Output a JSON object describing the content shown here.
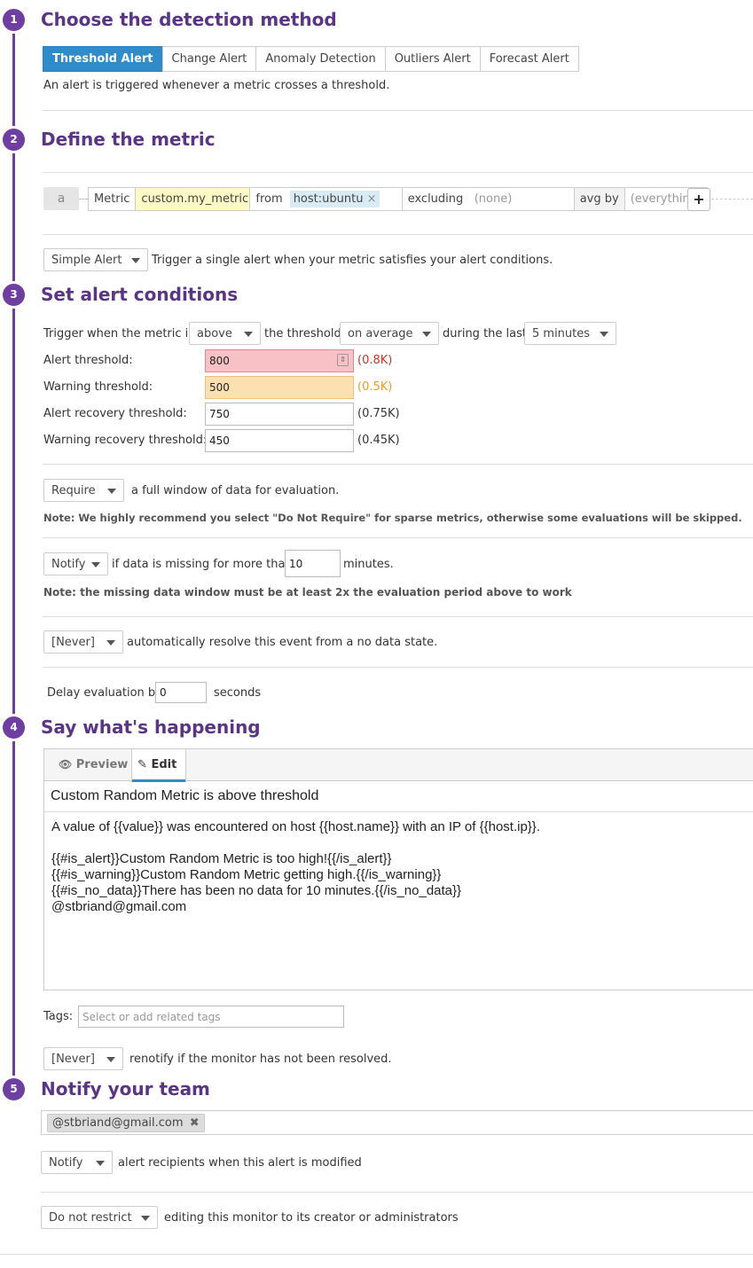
{
  "steps": [
    {
      "num": "1",
      "title": "Choose the detection method"
    },
    {
      "num": "2",
      "title": "Define the metric"
    },
    {
      "num": "3",
      "title": "Set alert conditions"
    },
    {
      "num": "4",
      "title": "Say what's happening"
    },
    {
      "num": "5",
      "title": "Notify your team"
    }
  ],
  "detection": {
    "tabs": [
      "Threshold Alert",
      "Change Alert",
      "Anomaly Detection",
      "Outliers Alert",
      "Forecast Alert"
    ],
    "active_tab": "Threshold Alert",
    "description": "An alert is triggered whenever a metric crosses a threshold."
  },
  "metric": {
    "query_letter": "a",
    "metric_label": "Metric",
    "metric_value": "custom.my_metric",
    "from_label": "from",
    "from_tag": "host:ubuntu",
    "from_tag_remove": "×",
    "excluding_label": "excluding",
    "excluding_value": "(none)",
    "avgby_label": "avg by",
    "avgby_value": "(everything)",
    "add_label": "+",
    "alert_type": "Simple Alert",
    "alert_type_desc": "Trigger a single alert when your metric satisfies your alert conditions."
  },
  "conditions": {
    "trigger_prefix": "Trigger when the metric is",
    "comparator": "above",
    "threshold_word": "the threshold",
    "aggregation": "on average",
    "during_word": "during the last",
    "window": "5 minutes",
    "alert_label": "Alert threshold:",
    "alert_value": "800",
    "alert_hint": "(0.8K)",
    "warning_label": "Warning threshold:",
    "warning_value": "500",
    "warning_hint": "(0.5K)",
    "alert_recovery_label": "Alert recovery threshold:",
    "alert_recovery_value": "750",
    "alert_recovery_hint": "(0.75K)",
    "warning_recovery_label": "Warning recovery threshold:",
    "warning_recovery_value": "450",
    "warning_recovery_hint": "(0.45K)",
    "require": "Require",
    "require_desc": "a full window of data for evaluation.",
    "require_note": "Note: We highly recommend you select \"Do Not Require\" for sparse metrics, otherwise some evaluations will be skipped.",
    "notify": "Notify",
    "notify_desc": "if data is missing for more than",
    "missing_minutes": "10",
    "minutes_word": "minutes.",
    "missing_note": "Note: the missing data window must be at least 2x the evaluation period above to work",
    "resolve": "[Never]",
    "resolve_desc": "automatically resolve this event from a no data state.",
    "delay_label": "Delay evaluation by",
    "delay_value": "0",
    "delay_unit": "seconds"
  },
  "message": {
    "preview_tab": "Preview",
    "edit_tab": "Edit",
    "subject": "Custom Random Metric is above threshold",
    "body": "A value of {{value}} was encountered on host {{host.name}} with an IP of {{host.ip}}.\n\n{{#is_alert}}Custom Random Metric is too high!{{/is_alert}}\n{{#is_warning}}Custom Random Metric getting high.{{/is_warning}}\n{{#is_no_data}}There has been no data for 10 minutes.{{/is_no_data}}\n@stbriand@gmail.com",
    "tags_label": "Tags:",
    "tags_placeholder": "Select or add related tags",
    "renotify": "[Never]",
    "renotify_desc": "renotify if the monitor has not been resolved."
  },
  "notify_team": {
    "recipient": "@stbriand@gmail.com",
    "recipient_remove": "✖",
    "modified_select": "Notify",
    "modified_desc": "alert recipients when this alert is modified",
    "restrict_select": "Do not restrict",
    "restrict_desc": "editing this monitor to its creator or administrators"
  },
  "colors": {
    "accent": "#6e3fa0",
    "tab_active": "#2f8cc8",
    "alert_bg": "#f7c1c5",
    "alert_text": "#c0392b",
    "warning_bg": "#fde0b2",
    "warning_text": "#e5a020",
    "metric_highlight": "#fdf8c4",
    "tag_highlight": "#d9ecf5"
  }
}
